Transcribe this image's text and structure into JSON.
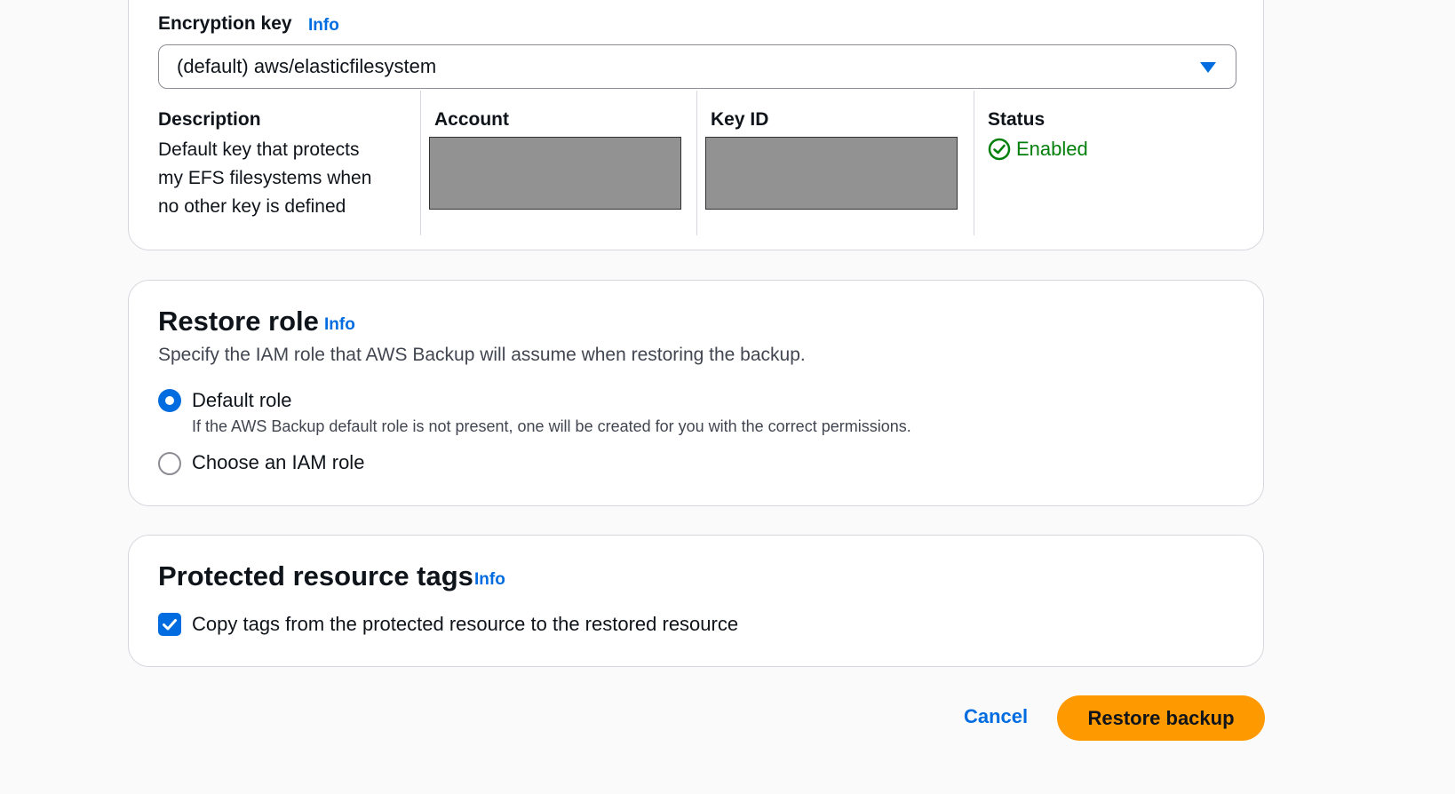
{
  "encryption": {
    "label": "Encryption key",
    "info": "Info",
    "selected_key": "(default) aws/elasticfilesystem",
    "columns": {
      "description_header": "Description",
      "description_lines": [
        "Default key that protects",
        "my EFS filesystems when",
        "no other key is defined"
      ],
      "account_header": "Account",
      "key_id_header": "Key ID",
      "status_header": "Status",
      "status_value": "Enabled",
      "status_color": "#037f0c"
    }
  },
  "restore_role": {
    "title": "Restore role",
    "info": "Info",
    "description": "Specify the IAM role that AWS Backup will assume when restoring the backup.",
    "options": [
      {
        "label": "Default role",
        "help": "If the AWS Backup default role is not present, one will be created for you with the correct permissions.",
        "checked": true
      },
      {
        "label": "Choose an IAM role",
        "checked": false
      }
    ]
  },
  "tags": {
    "title": "Protected resource tags",
    "info": "Info",
    "copy_label": "Copy tags from the protected resource to the restored resource",
    "copy_checked": true
  },
  "actions": {
    "cancel": "Cancel",
    "restore": "Restore backup"
  },
  "colors": {
    "accent": "#006ce0",
    "primary_button": "#ff9900",
    "success": "#037f0c"
  }
}
